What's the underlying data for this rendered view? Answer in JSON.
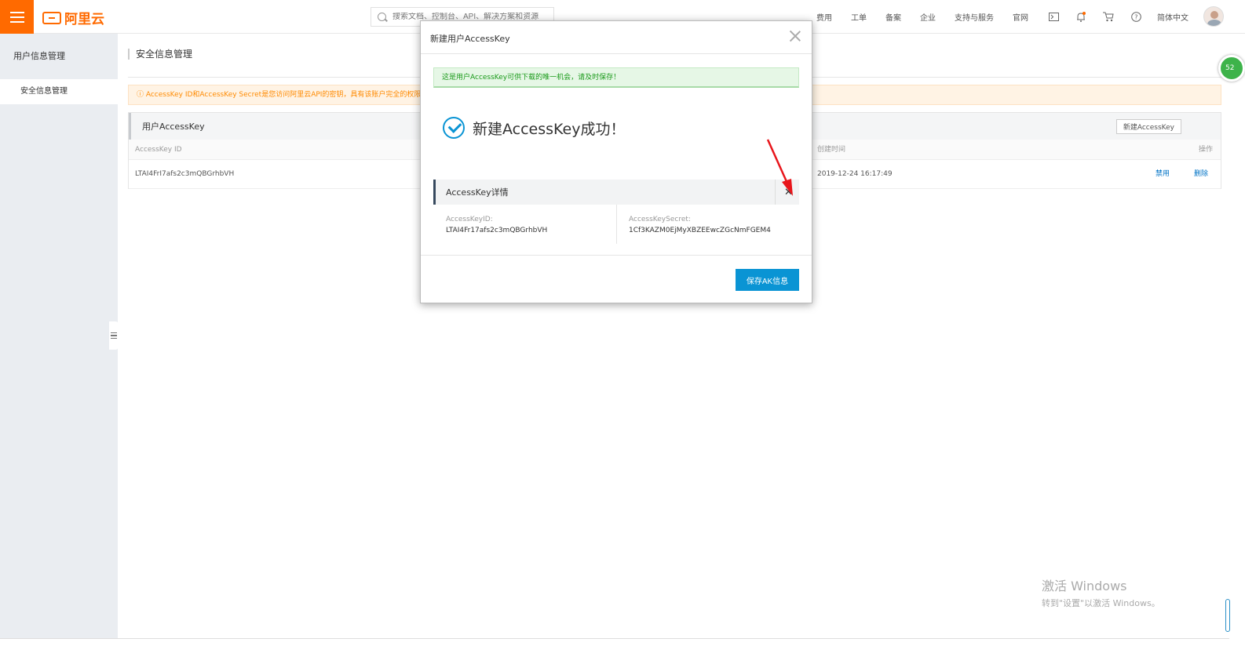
{
  "topbar": {
    "brand": "阿里云",
    "search_placeholder": "搜索文档、控制台、API、解决方案和资源",
    "nav": [
      "费用",
      "工单",
      "备案",
      "企业",
      "支持与服务",
      "官网"
    ],
    "icons": [
      "terminal-icon",
      "bell-icon",
      "cart-icon",
      "help-icon"
    ],
    "language": "简体中文"
  },
  "sidebar": {
    "title": "用户信息管理",
    "items": [
      {
        "label": "安全信息管理"
      }
    ]
  },
  "main": {
    "page_title": "安全信息管理",
    "warning": "ⓘ AccessKey ID和AccessKey Secret是您访问阿里云API的密钥，具有该账户完全的权限，请您妥善保管。",
    "panel_title": "用户AccessKey",
    "new_button": "新建AccessKey",
    "columns": {
      "id": "AccessKey ID",
      "created": "创建时间",
      "actions": "操作"
    },
    "rows": [
      {
        "id": "LTAI4FrI7afs2c3mQBGrhbVH",
        "created": "2019-12-24 16:17:49",
        "disable": "禁用",
        "delete": "删除"
      }
    ]
  },
  "modal": {
    "title": "新建用户AccessKey",
    "tip": "这是用户AccessKey可供下载的唯一机会，请及时保存！",
    "success": "新建AccessKey成功！",
    "details_title": "AccessKey详情",
    "details_close": "✕",
    "id_label": "AccessKeyID:",
    "id_value": "LTAI4Fr17afs2c3mQBGrhbVH",
    "secret_label": "AccessKeySecret:",
    "secret_value": "1Cf3KAZM0EjMyXBZEEwcZGcNmFGEM4",
    "save_button": "保存AK信息"
  },
  "watermark": {
    "line1": "激活 Windows",
    "line2": "转到\"设置\"以激活 Windows。"
  },
  "float_badge": "52",
  "colors": {
    "brand": "#ff6a00",
    "primary": "#0a94d4",
    "link": "#0073c6",
    "success_bg": "#e6f7e6",
    "warning_bg": "#fff3e4",
    "arrow": "#e8151b"
  }
}
